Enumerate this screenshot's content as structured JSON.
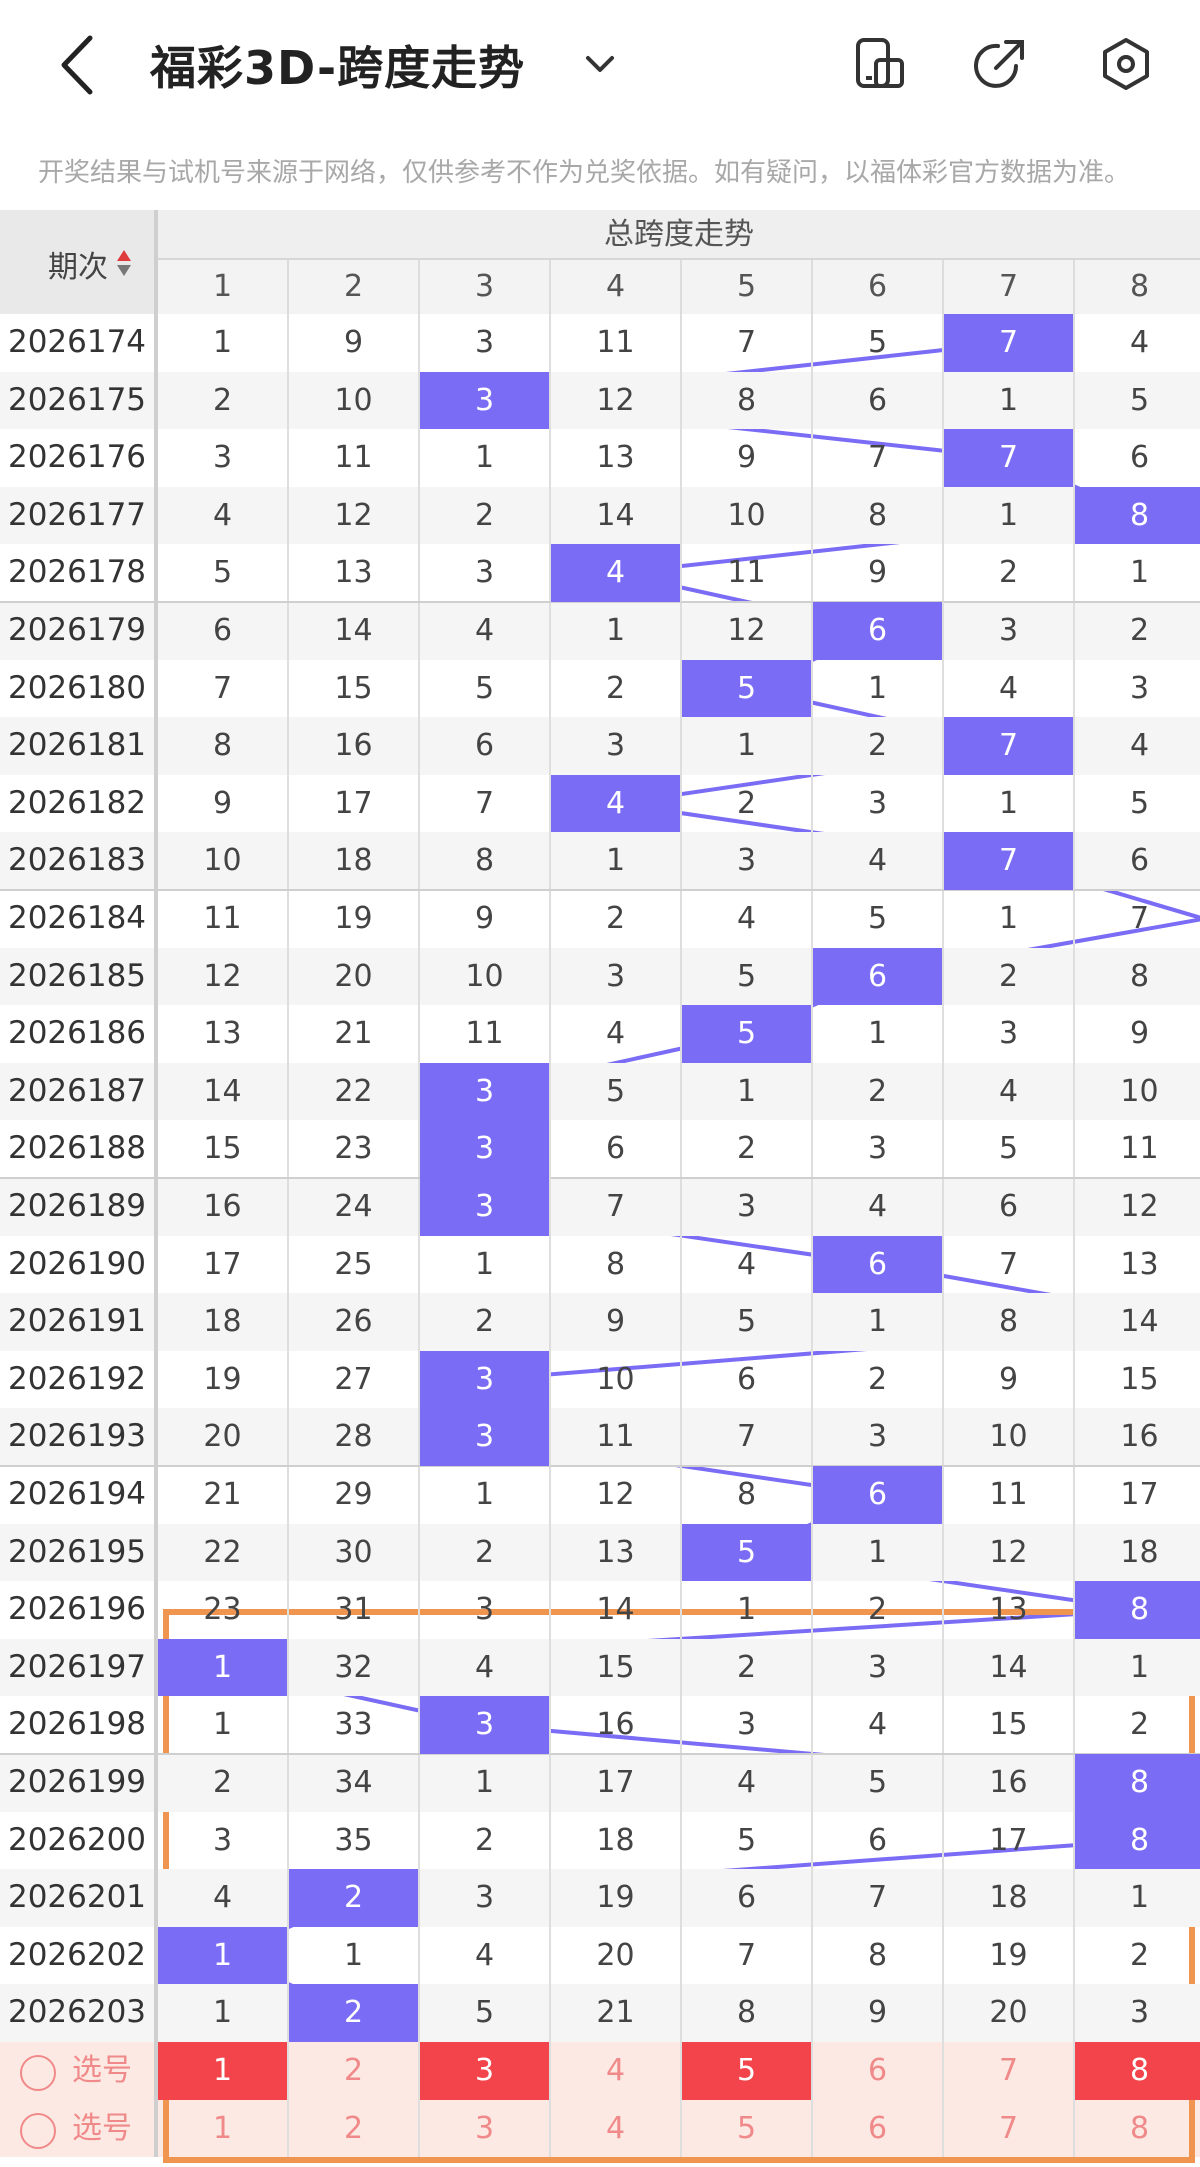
{
  "header": {
    "title": "福彩3D-跨度走势",
    "icons": [
      "back-icon",
      "chevron-down-icon",
      "phone-icon",
      "share-icon",
      "settings-icon"
    ]
  },
  "notice": "开奖结果与试机号来源于网络，仅供参考不作为兑奖依据。如有疑问，以福体彩官方数据为准。",
  "table": {
    "period_header": "期次",
    "group_header": "总跨度走势",
    "columns": [
      "1",
      "2",
      "3",
      "4",
      "5",
      "6",
      "7",
      "8"
    ],
    "rows": [
      {
        "period": "2026174",
        "cells": [
          "1",
          "9",
          "3",
          "11",
          "7",
          "5",
          "7",
          "4"
        ],
        "hit": 6
      },
      {
        "period": "2026175",
        "cells": [
          "2",
          "10",
          "3",
          "12",
          "8",
          "6",
          "1",
          "5"
        ],
        "hit": 2
      },
      {
        "period": "2026176",
        "cells": [
          "3",
          "11",
          "1",
          "13",
          "9",
          "7",
          "7",
          "6"
        ],
        "hit": 6
      },
      {
        "period": "2026177",
        "cells": [
          "4",
          "12",
          "2",
          "14",
          "10",
          "8",
          "1",
          "8"
        ],
        "hit": 7
      },
      {
        "period": "2026178",
        "cells": [
          "5",
          "13",
          "3",
          "4",
          "11",
          "9",
          "2",
          "1"
        ],
        "hit": 3
      },
      {
        "period": "2026179",
        "cells": [
          "6",
          "14",
          "4",
          "1",
          "12",
          "6",
          "3",
          "2"
        ],
        "hit": 5
      },
      {
        "period": "2026180",
        "cells": [
          "7",
          "15",
          "5",
          "2",
          "5",
          "1",
          "4",
          "3"
        ],
        "hit": 4
      },
      {
        "period": "2026181",
        "cells": [
          "8",
          "16",
          "6",
          "3",
          "1",
          "2",
          "7",
          "4"
        ],
        "hit": 6
      },
      {
        "period": "2026182",
        "cells": [
          "9",
          "17",
          "7",
          "4",
          "2",
          "3",
          "1",
          "5"
        ],
        "hit": 3
      },
      {
        "period": "2026183",
        "cells": [
          "10",
          "18",
          "8",
          "1",
          "3",
          "4",
          "7",
          "6"
        ],
        "hit": 6
      },
      {
        "period": "2026184",
        "cells": [
          "11",
          "19",
          "9",
          "2",
          "4",
          "5",
          "1",
          "7"
        ],
        "hit": -1
      },
      {
        "period": "2026185",
        "cells": [
          "12",
          "20",
          "10",
          "3",
          "5",
          "6",
          "2",
          "8"
        ],
        "hit": 5
      },
      {
        "period": "2026186",
        "cells": [
          "13",
          "21",
          "11",
          "4",
          "5",
          "1",
          "3",
          "9"
        ],
        "hit": 4
      },
      {
        "period": "2026187",
        "cells": [
          "14",
          "22",
          "3",
          "5",
          "1",
          "2",
          "4",
          "10"
        ],
        "hit": 2
      },
      {
        "period": "2026188",
        "cells": [
          "15",
          "23",
          "3",
          "6",
          "2",
          "3",
          "5",
          "11"
        ],
        "hit": 2
      },
      {
        "period": "2026189",
        "cells": [
          "16",
          "24",
          "3",
          "7",
          "3",
          "4",
          "6",
          "12"
        ],
        "hit": 2
      },
      {
        "period": "2026190",
        "cells": [
          "17",
          "25",
          "1",
          "8",
          "4",
          "6",
          "7",
          "13"
        ],
        "hit": 5
      },
      {
        "period": "2026191",
        "cells": [
          "18",
          "26",
          "2",
          "9",
          "5",
          "1",
          "8",
          "14"
        ],
        "hit": -1
      },
      {
        "period": "2026192",
        "cells": [
          "19",
          "27",
          "3",
          "10",
          "6",
          "2",
          "9",
          "15"
        ],
        "hit": 2
      },
      {
        "period": "2026193",
        "cells": [
          "20",
          "28",
          "3",
          "11",
          "7",
          "3",
          "10",
          "16"
        ],
        "hit": 2
      },
      {
        "period": "2026194",
        "cells": [
          "21",
          "29",
          "1",
          "12",
          "8",
          "6",
          "11",
          "17"
        ],
        "hit": 5
      },
      {
        "period": "2026195",
        "cells": [
          "22",
          "30",
          "2",
          "13",
          "5",
          "1",
          "12",
          "18"
        ],
        "hit": 4
      },
      {
        "period": "2026196",
        "cells": [
          "23",
          "31",
          "3",
          "14",
          "1",
          "2",
          "13",
          "8"
        ],
        "hit": 7
      },
      {
        "period": "2026197",
        "cells": [
          "1",
          "32",
          "4",
          "15",
          "2",
          "3",
          "14",
          "1"
        ],
        "hit": 0
      },
      {
        "period": "2026198",
        "cells": [
          "1",
          "33",
          "3",
          "16",
          "3",
          "4",
          "15",
          "2"
        ],
        "hit": 2
      },
      {
        "period": "2026199",
        "cells": [
          "2",
          "34",
          "1",
          "17",
          "4",
          "5",
          "16",
          "8"
        ],
        "hit": 7
      },
      {
        "period": "2026200",
        "cells": [
          "3",
          "35",
          "2",
          "18",
          "5",
          "6",
          "17",
          "8"
        ],
        "hit": 7
      },
      {
        "period": "2026201",
        "cells": [
          "4",
          "2",
          "3",
          "19",
          "6",
          "7",
          "18",
          "1"
        ],
        "hit": 1
      },
      {
        "period": "2026202",
        "cells": [
          "1",
          "1",
          "4",
          "20",
          "7",
          "8",
          "19",
          "2"
        ],
        "hit": 0
      },
      {
        "period": "2026203",
        "cells": [
          "1",
          "2",
          "5",
          "21",
          "8",
          "9",
          "20",
          "3"
        ],
        "hit": 1
      }
    ],
    "select_rows": [
      {
        "label": "选号",
        "cells": [
          "1",
          "2",
          "3",
          "4",
          "5",
          "6",
          "7",
          "8"
        ],
        "selected": [
          0,
          2,
          4,
          7
        ]
      },
      {
        "label": "选号",
        "cells": [
          "1",
          "2",
          "3",
          "4",
          "5",
          "6",
          "7",
          "8"
        ],
        "selected": []
      }
    ]
  },
  "colors": {
    "hit": "#7b6cf6",
    "line": "#7b6cf6",
    "selected": "#f2444a",
    "select_text": "#f08a8a",
    "select_bg": "#fde9e3",
    "highlight_box": "#ef9550"
  }
}
